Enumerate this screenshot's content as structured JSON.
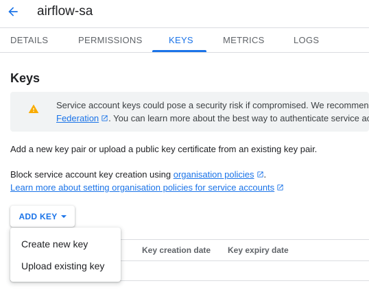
{
  "header": {
    "title": "airflow-sa",
    "back_icon": "arrow-back-icon"
  },
  "tabs": [
    {
      "label": "DETAILS",
      "active": false
    },
    {
      "label": "PERMISSIONS",
      "active": false
    },
    {
      "label": "KEYS",
      "active": true
    },
    {
      "label": "METRICS",
      "active": false
    },
    {
      "label": "LOGS",
      "active": false
    }
  ],
  "keys": {
    "title": "Keys",
    "warning": {
      "icon": "warning-icon",
      "line1": "Service account keys could pose a security risk if compromised. We recommen",
      "link_federation": "Federation",
      "line2_rest": ". You can learn more about the best way to authenticate service ac"
    },
    "intro": "Add a new key pair or upload a public key certificate from an existing key pair.",
    "policy_prefix": "Block service account key creation using ",
    "policy_link": "organisation policies",
    "policy_suffix": ".",
    "learn_more": "Learn more about setting organisation policies for service accounts",
    "add_key_button": "ADD KEY",
    "menu": [
      "Create new key",
      "Upload existing key"
    ],
    "table_headers": [
      "Key creation date",
      "Key expiry date"
    ]
  },
  "colors": {
    "accent": "#1a73e8",
    "warning": "#f9ab00",
    "info_bg": "#f1f3f4"
  }
}
